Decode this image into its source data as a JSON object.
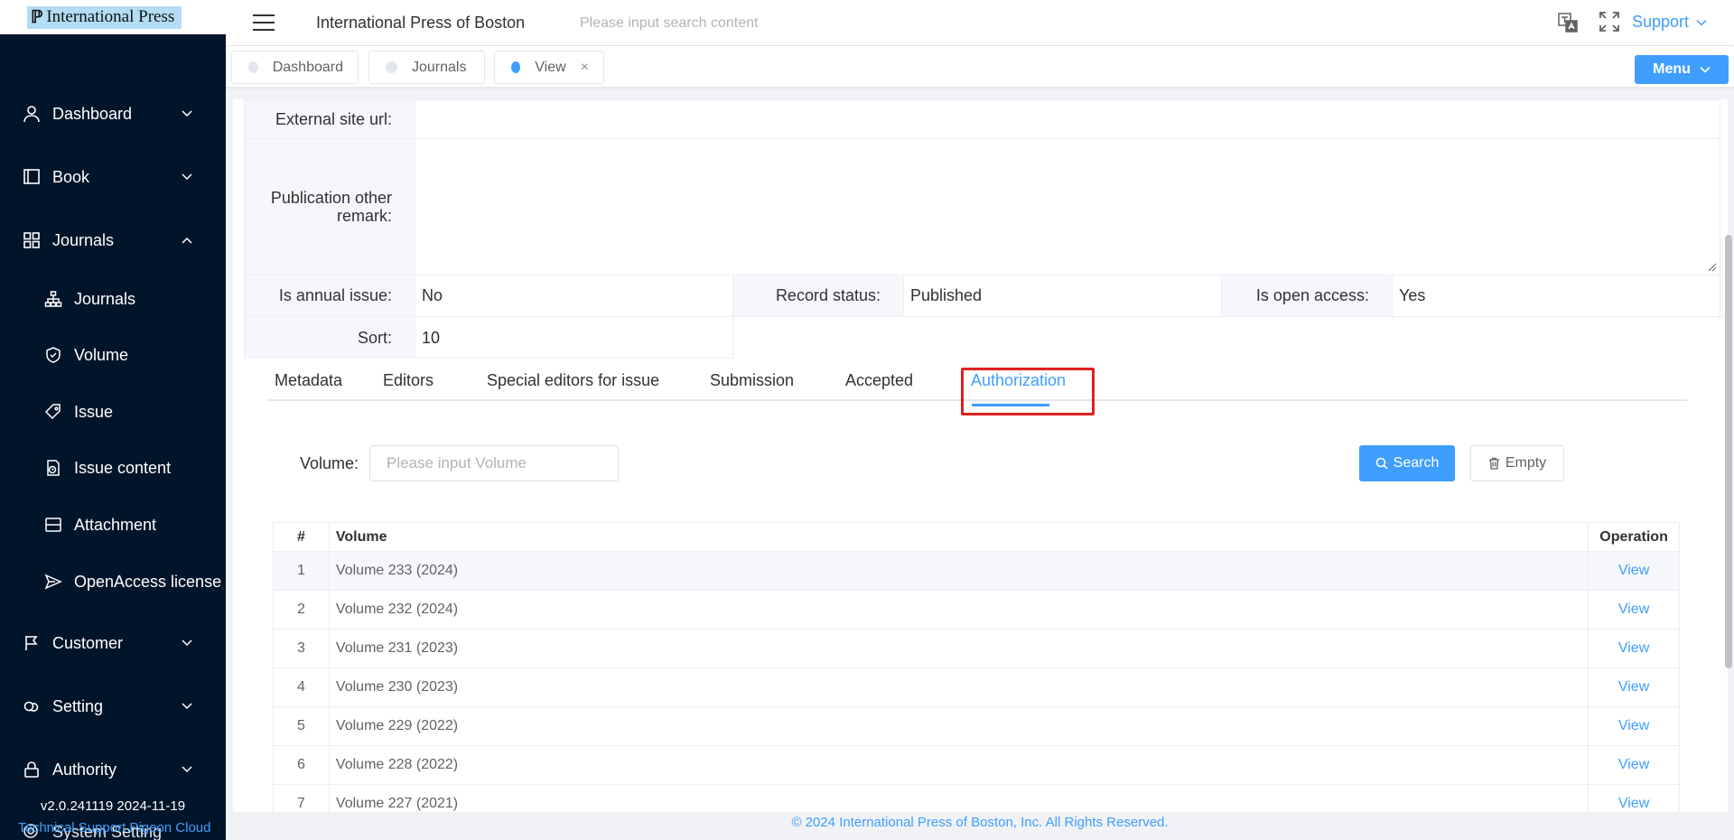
{
  "app": {
    "logo_text": "International Press",
    "title": "International Press of Boston"
  },
  "header": {
    "search_placeholder": "Please input search content",
    "support_label": "Support"
  },
  "sidebar": {
    "items": [
      {
        "label": "Dashboard",
        "icon": "user-icon"
      },
      {
        "label": "Book",
        "icon": "book-icon"
      },
      {
        "label": "Journals",
        "icon": "grid-icon"
      },
      {
        "label": "Journals",
        "icon": "sitemap-icon"
      },
      {
        "label": "Volume",
        "icon": "shield-icon"
      },
      {
        "label": "Issue",
        "icon": "tag-icon"
      },
      {
        "label": "Issue content",
        "icon": "clock-document-icon"
      },
      {
        "label": "Attachment",
        "icon": "box-icon"
      },
      {
        "label": "OpenAccess license",
        "icon": "send-icon"
      },
      {
        "label": "Customer",
        "icon": "flag-icon"
      },
      {
        "label": "Setting",
        "icon": "cloud-icon"
      },
      {
        "label": "Authority",
        "icon": "lock-icon"
      },
      {
        "label": "System Setting",
        "icon": "gear-icon"
      }
    ],
    "version": "v2.0.241119 2024-11-19",
    "support_text": "Technical Support Pigeon Cloud"
  },
  "tags": [
    {
      "label": "Dashboard",
      "active": false
    },
    {
      "label": "Journals",
      "active": false
    },
    {
      "label": "View",
      "active": true
    }
  ],
  "menu_button": "Menu",
  "details": {
    "external_site_url_label": "External site url:",
    "external_site_url_value": "",
    "publication_remark_label": "Publication other remark:",
    "publication_remark_value": "",
    "is_annual_issue_label": "Is annual issue:",
    "is_annual_issue_value": "No",
    "record_status_label": "Record status:",
    "record_status_value": "Published",
    "is_open_access_label": "Is open access:",
    "is_open_access_value": "Yes",
    "sort_label": "Sort:",
    "sort_value": "10"
  },
  "tabs": [
    {
      "label": "Metadata"
    },
    {
      "label": "Editors"
    },
    {
      "label": "Special editors for issue"
    },
    {
      "label": "Submission"
    },
    {
      "label": "Accepted"
    },
    {
      "label": "Authorization",
      "active": true
    }
  ],
  "filter": {
    "volume_label": "Volume:",
    "volume_placeholder": "Please input Volume",
    "search_label": "Search",
    "empty_label": "Empty"
  },
  "table": {
    "headers": {
      "index": "#",
      "volume": "Volume",
      "operation": "Operation"
    },
    "rows": [
      {
        "index": "1",
        "volume": "Volume 233 (2024)",
        "action": "View"
      },
      {
        "index": "2",
        "volume": "Volume 232 (2024)",
        "action": "View"
      },
      {
        "index": "3",
        "volume": "Volume 231 (2023)",
        "action": "View"
      },
      {
        "index": "4",
        "volume": "Volume 230 (2023)",
        "action": "View"
      },
      {
        "index": "5",
        "volume": "Volume 229 (2022)",
        "action": "View"
      },
      {
        "index": "6",
        "volume": "Volume 228 (2022)",
        "action": "View"
      },
      {
        "index": "7",
        "volume": "Volume 227 (2021)",
        "action": "View"
      }
    ]
  },
  "footer": "© 2024 International Press of Boston, Inc. All Rights Reserved.",
  "colors": {
    "sidebar_bg": "#001529",
    "accent": "#409eff",
    "highlight": "#e02020"
  }
}
